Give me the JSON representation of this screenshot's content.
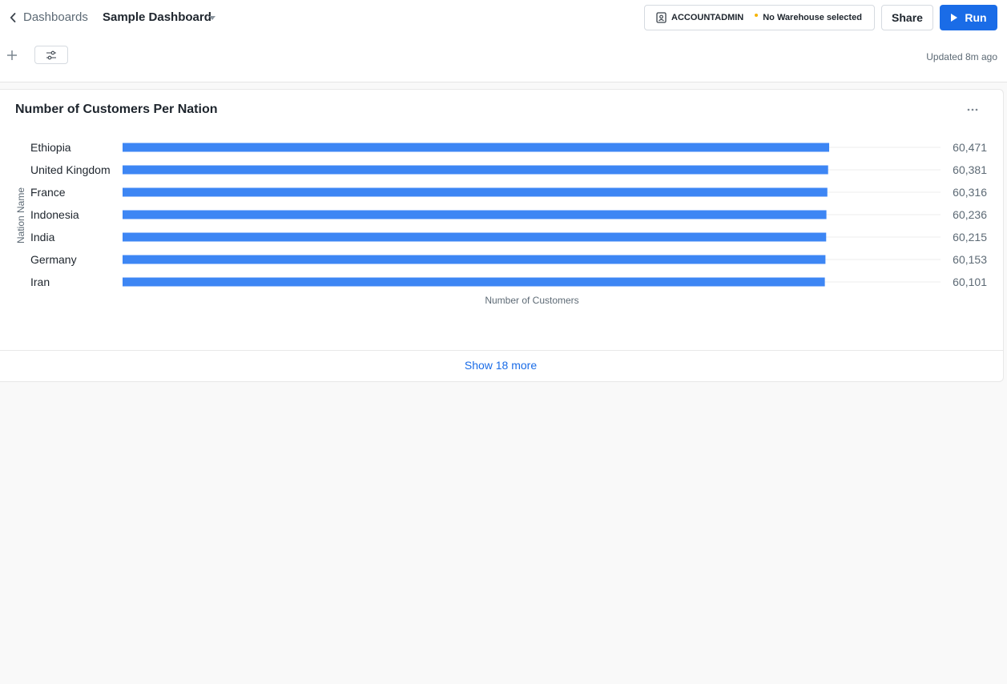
{
  "header": {
    "breadcrumb": "Dashboards",
    "dashboard_title": "Sample Dashboard",
    "role": "ACCOUNTADMIN",
    "warehouse_status": "No Warehouse selected",
    "share_label": "Share",
    "run_label": "Run",
    "updated": "Updated 8m ago"
  },
  "icons": {
    "back": "chevron-left-icon",
    "caret": "caret-down-icon",
    "role": "user-badge-icon",
    "run": "play-icon",
    "add": "plus-icon",
    "filters": "sliders-icon",
    "more": "ellipsis-icon"
  },
  "tile": {
    "title": "Number of Customers Per Nation",
    "show_more": "Show 18 more"
  },
  "colors": {
    "accent": "#1a6ce7",
    "bar": "#3d86f4",
    "warning_dot": "#f5b400"
  },
  "chart_data": {
    "type": "bar",
    "orientation": "horizontal",
    "categories": [
      "Ethiopia",
      "United Kingdom",
      "France",
      "Indonesia",
      "India",
      "Germany",
      "Iran"
    ],
    "values": [
      60471,
      60381,
      60316,
      60236,
      60215,
      60153,
      60101
    ],
    "value_labels": [
      "60,471",
      "60,381",
      "60,316",
      "60,236",
      "60,215",
      "60,153",
      "60,101"
    ],
    "xlabel": "Number of Customers",
    "ylabel": "Nation Name",
    "xlim": [
      0,
      70000
    ],
    "grid": true
  }
}
